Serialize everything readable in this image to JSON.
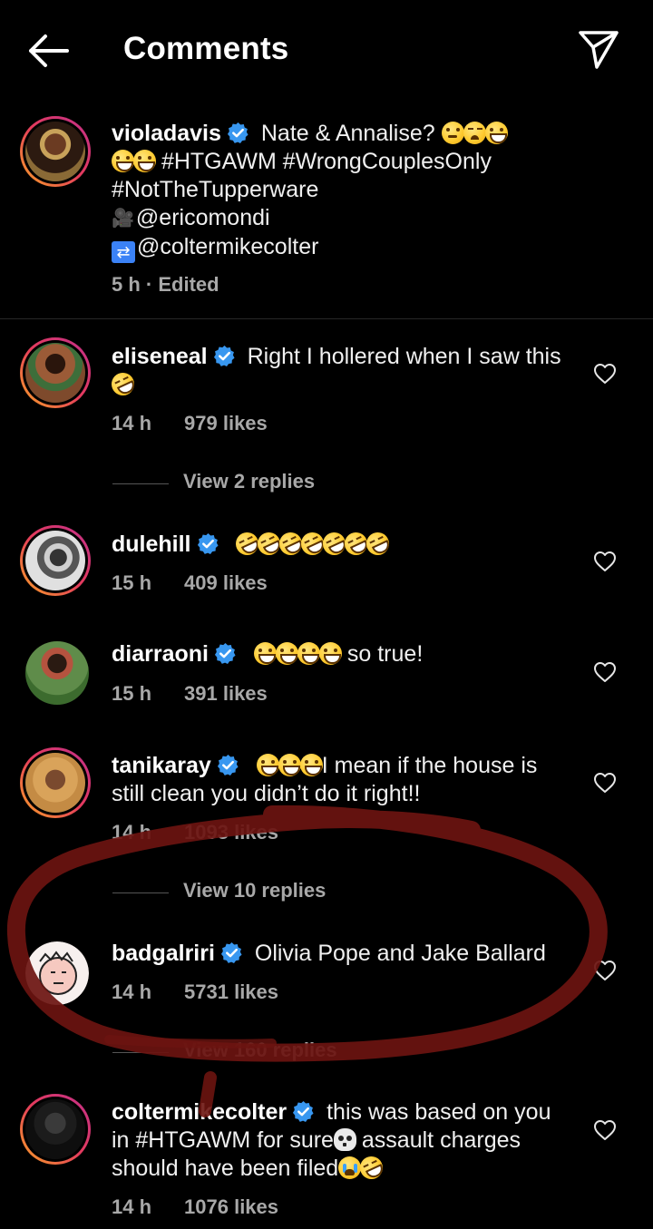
{
  "header": {
    "title": "Comments"
  },
  "caption": {
    "username": "violadavis",
    "lines": {
      "l1": "Nate & Annalise?",
      "l2": "#HTGAWM #WrongCouplesOnly",
      "l3": "#NotTheTupperware",
      "l4": "@ericomondi",
      "l5": "@coltermikecolter"
    },
    "time": "5 h",
    "edited": "· Edited"
  },
  "comments": [
    {
      "username": "eliseneal",
      "text": "Right I hollered when I saw this",
      "time": "14 h",
      "likes": "979 likes",
      "replies": "View 2 replies"
    },
    {
      "username": "dulehill",
      "time": "15 h",
      "likes": "409 likes"
    },
    {
      "username": "diarraoni",
      "text": "so true!",
      "time": "15 h",
      "likes": "391 likes"
    },
    {
      "username": "tanikaray",
      "text1": "I mean if the house is",
      "text2": "still clean you didn’t do it right!!",
      "time": "14 h",
      "likes": "1093 likes",
      "replies": "View 10 replies"
    },
    {
      "username": "badgalriri",
      "text": "Olivia Pope and Jake Ballard",
      "time": "14 h",
      "likes": "5731 likes",
      "replies": "View 160 replies"
    },
    {
      "username": "coltermikecolter",
      "text1": "this was based on you",
      "text2": "in #HTGAWM for sure",
      "text2b": "assault charges",
      "text3": "should have been filed",
      "time": "14 h",
      "likes": "1076 likes"
    }
  ],
  "colors": {
    "background": "#000000",
    "verified": "#3897f0",
    "secondary_text": "#a8a8a8",
    "annotation_ink": "#6b1410"
  },
  "icons": {
    "back": "back-arrow-icon",
    "share": "paper-plane-icon",
    "like": "heart-icon",
    "verified": "verified-badge-icon"
  }
}
